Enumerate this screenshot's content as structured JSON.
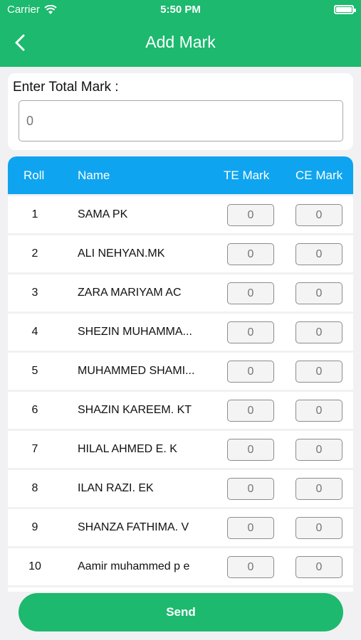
{
  "status_bar": {
    "carrier": "Carrier",
    "time": "5:50 PM"
  },
  "header": {
    "title": "Add Mark",
    "back_icon": "chevron-left-icon"
  },
  "total": {
    "label": "Enter Total Mark :",
    "value": "0"
  },
  "table": {
    "columns": {
      "roll": "Roll",
      "name": "Name",
      "te": "TE Mark",
      "ce": "CE Mark"
    },
    "rows": [
      {
        "roll": "1",
        "name": "SAMA PK",
        "te": "0",
        "ce": "0"
      },
      {
        "roll": "2",
        "name": "ALI NEHYAN.MK",
        "te": "0",
        "ce": "0"
      },
      {
        "roll": "3",
        "name": "ZARA MARIYAM AC",
        "te": "0",
        "ce": "0"
      },
      {
        "roll": "4",
        "name": "SHEZIN MUHAMMA...",
        "te": "0",
        "ce": "0"
      },
      {
        "roll": "5",
        "name": "MUHAMMED SHAMI...",
        "te": "0",
        "ce": "0"
      },
      {
        "roll": "6",
        "name": "SHAZIN KAREEM. KT",
        "te": "0",
        "ce": "0"
      },
      {
        "roll": "7",
        "name": "HILAL AHMED E. K",
        "te": "0",
        "ce": "0"
      },
      {
        "roll": "8",
        "name": "ILAN RAZI. EK",
        "te": "0",
        "ce": "0"
      },
      {
        "roll": "9",
        "name": "SHANZA FATHIMA. V",
        "te": "0",
        "ce": "0"
      },
      {
        "roll": "10",
        "name": "Aamir muhammed p e",
        "te": "0",
        "ce": "0"
      }
    ]
  },
  "send_label": "Send",
  "colors": {
    "primary_green": "#1cb96e",
    "header_blue": "#0fa4ef"
  }
}
